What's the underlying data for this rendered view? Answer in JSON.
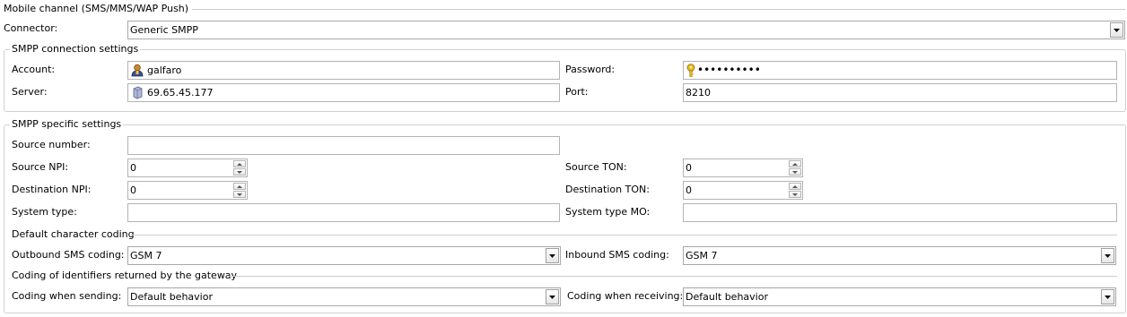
{
  "mobile_channel": {
    "title": "Mobile channel (SMS/MMS/WAP Push)",
    "connector_label": "Connector:",
    "connector_value": "Generic SMPP"
  },
  "connection": {
    "title": "SMPP connection settings",
    "account_label": "Account:",
    "account_value": "galfaro",
    "password_label": "Password:",
    "password_value": "••••••••••",
    "server_label": "Server:",
    "server_value": "69.65.45.177",
    "port_label": "Port:",
    "port_value": "8210",
    "icons": {
      "account": "user-icon",
      "password": "key-icon",
      "server": "server-icon"
    }
  },
  "specific": {
    "title": "SMPP specific settings",
    "source_number_label": "Source number:",
    "source_number_value": "",
    "source_npi_label": "Source NPI:",
    "source_npi_value": "0",
    "source_ton_label": "Source TON:",
    "source_ton_value": "0",
    "dest_npi_label": "Destination NPI:",
    "dest_npi_value": "0",
    "dest_ton_label": "Destination TON:",
    "dest_ton_value": "0",
    "system_type_label": "System type:",
    "system_type_value": "",
    "system_type_mo_label": "System type MO:",
    "system_type_mo_value": "",
    "coding_section_title": "Default character coding",
    "outbound_label": "Outbound SMS coding:",
    "outbound_value": "GSM 7",
    "inbound_label": "Inbound SMS coding:",
    "inbound_value": "GSM 7",
    "identifiers_section_title": "Coding of identifiers returned by the gateway",
    "sending_label": "Coding when sending:",
    "sending_value": "Default behavior",
    "receiving_label": "Coding when receiving:",
    "receiving_value": "Default behavior"
  }
}
